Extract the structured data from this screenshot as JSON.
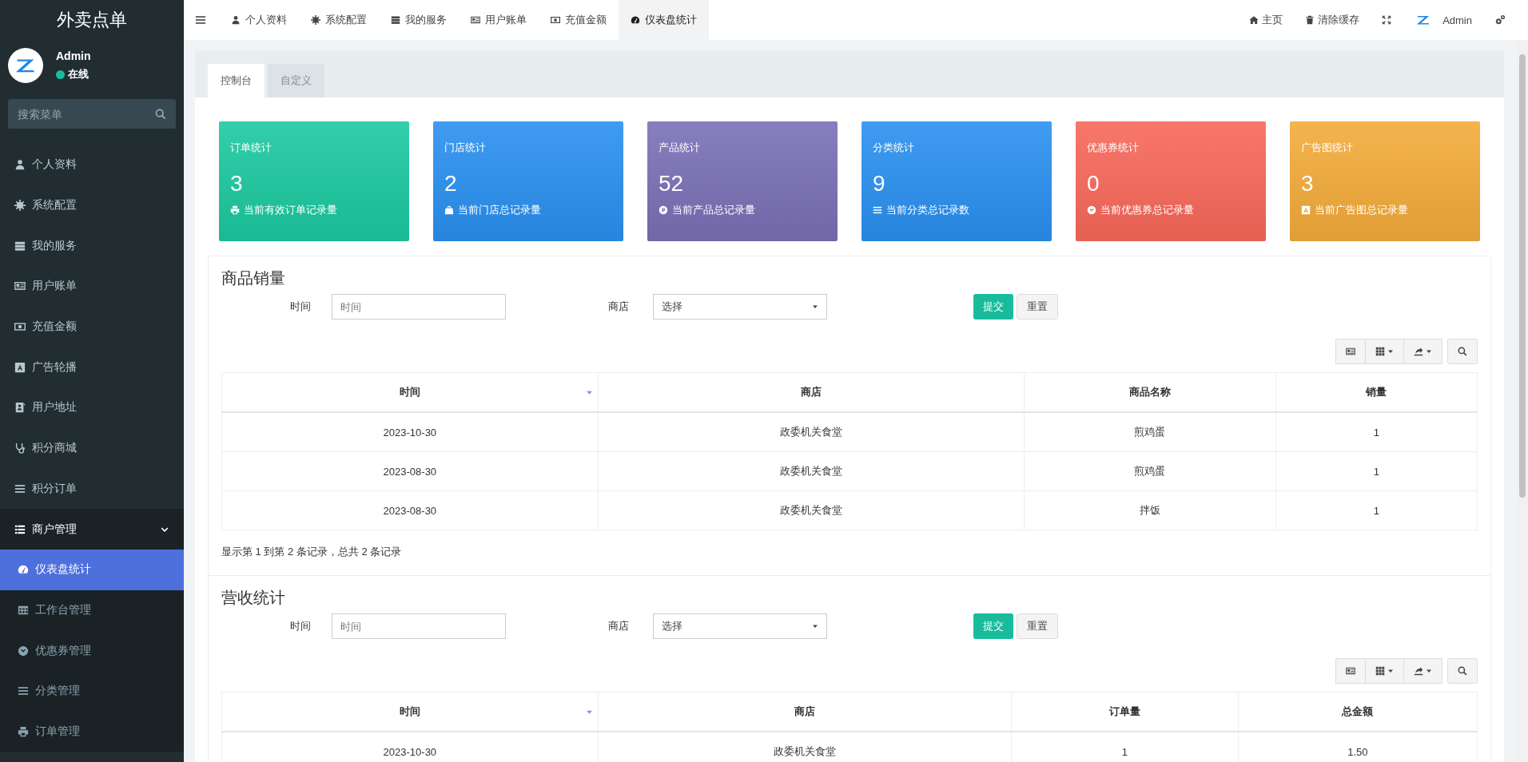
{
  "sidebar": {
    "brand": "外卖点单",
    "user": {
      "name": "Admin",
      "status": "在线",
      "online": true
    },
    "search": {
      "placeholder": "搜索菜单"
    },
    "items": [
      {
        "kind": "item",
        "label": "个人资料",
        "selected": false
      },
      {
        "kind": "item",
        "label": "系统配置",
        "selected": false
      },
      {
        "kind": "item",
        "label": "我的服务",
        "selected": false
      },
      {
        "kind": "item",
        "label": "用户账单",
        "selected": false
      },
      {
        "kind": "item",
        "label": "充值金额",
        "selected": false
      },
      {
        "kind": "item",
        "label": "广告轮播",
        "selected": false
      },
      {
        "kind": "item",
        "label": "用户地址",
        "selected": false
      },
      {
        "kind": "item",
        "label": "积分商城",
        "selected": false
      },
      {
        "kind": "item",
        "label": "积分订单",
        "selected": false
      },
      {
        "kind": "group",
        "label": "商户管理",
        "selected": false,
        "expanded": true,
        "children": [
          {
            "label": "仪表盘统计",
            "selected": true
          },
          {
            "label": "工作台管理",
            "selected": false
          },
          {
            "label": "优惠券管理",
            "selected": false
          },
          {
            "label": "分类管理",
            "selected": false
          },
          {
            "label": "订单管理",
            "selected": false
          }
        ]
      }
    ]
  },
  "topbar": {
    "tabs": [
      {
        "label": "个人资料",
        "selected": false
      },
      {
        "label": "系统配置",
        "selected": false
      },
      {
        "label": "我的服务",
        "selected": false
      },
      {
        "label": "用户账单",
        "selected": false
      },
      {
        "label": "充值金额",
        "selected": false
      },
      {
        "label": "仪表盘统计",
        "selected": true
      }
    ],
    "links": [
      "主页",
      "清除缓存"
    ],
    "user": "Admin"
  },
  "page_tabs": [
    {
      "label": "控制台",
      "selected": true
    },
    {
      "label": "自定义",
      "selected": false
    }
  ],
  "cards": [
    {
      "title": "订单统计",
      "value": "3",
      "caption": "当前有效订单记录量",
      "color": "#1bc9a0"
    },
    {
      "title": "门店统计",
      "value": "2",
      "caption": "当前门店总记录量",
      "color": "#2a90f0"
    },
    {
      "title": "产品统计",
      "value": "52",
      "caption": "当前产品总记录量",
      "color": "#7a70b6"
    },
    {
      "title": "分类统计",
      "value": "9",
      "caption": "当前分类总记录数",
      "color": "#2a90f0"
    },
    {
      "title": "优惠券统计",
      "value": "0",
      "caption": "当前优惠券总记录量",
      "color": "#f8685a"
    },
    {
      "title": "广告图统计",
      "value": "3",
      "caption": "当前广告图总记录量",
      "color": "#f4ab3a"
    }
  ],
  "sections": [
    {
      "title": "商品销量",
      "filters": {
        "time_label": "时间",
        "time_placeholder": "时间",
        "shop_label": "商店",
        "shop_value": "选择",
        "submit": "提交",
        "reset": "重置"
      },
      "table": {
        "columns": [
          {
            "label": "时间",
            "sorted": true
          },
          {
            "label": "商店",
            "sorted": false
          },
          {
            "label": "商品名称",
            "sorted": false
          },
          {
            "label": "销量",
            "sorted": false
          }
        ],
        "rows": [
          [
            "2023-10-30",
            "政委机关食堂",
            "煎鸡蛋",
            "1"
          ],
          [
            "2023-08-30",
            "政委机关食堂",
            "煎鸡蛋",
            "1"
          ],
          [
            "2023-08-30",
            "政委机关食堂",
            "拌饭",
            "1"
          ]
        ]
      },
      "footer": "显示第 1 到第 2 条记录，总共 2 条记录"
    },
    {
      "title": "营收统计",
      "filters": {
        "time_label": "时间",
        "time_placeholder": "时间",
        "shop_label": "商店",
        "shop_value": "选择",
        "submit": "提交",
        "reset": "重置"
      },
      "table": {
        "columns": [
          {
            "label": "时间",
            "sorted": true
          },
          {
            "label": "商店",
            "sorted": false
          },
          {
            "label": "订单量",
            "sorted": false
          },
          {
            "label": "总金额",
            "sorted": false
          }
        ],
        "rows": [
          [
            "2023-10-30",
            "政委机关食堂",
            "1",
            "1.50"
          ]
        ]
      }
    }
  ]
}
